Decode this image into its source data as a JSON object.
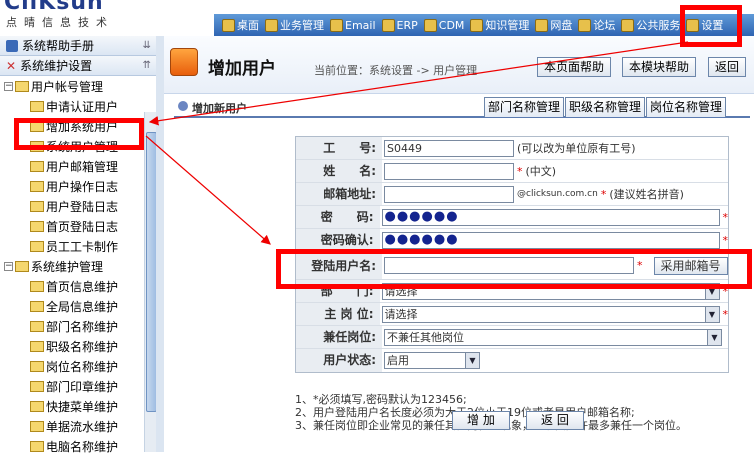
{
  "header": {
    "logo_text": "CliKsun",
    "logo_sub": "点晴信息技术",
    "nav_items": [
      {
        "label": "桌面",
        "icon": "desktop-icon"
      },
      {
        "label": "业务管理",
        "icon": "business-icon"
      },
      {
        "label": "Email",
        "icon": "email-icon"
      },
      {
        "label": "ERP",
        "icon": "erp-icon"
      },
      {
        "label": "CDM",
        "icon": "cdm-icon"
      },
      {
        "label": "知识管理",
        "icon": "knowledge-icon"
      },
      {
        "label": "网盘",
        "icon": "disk-icon"
      },
      {
        "label": "论坛",
        "icon": "forum-icon"
      },
      {
        "label": "公共服务",
        "icon": "service-icon"
      },
      {
        "label": "设置",
        "icon": "settings-icon"
      }
    ]
  },
  "sidebar": {
    "sections": [
      {
        "label": "系统帮助手册"
      },
      {
        "label": "系统维护设置"
      }
    ],
    "tree": [
      {
        "label": "用户帐号管理",
        "level": 0,
        "expanded": true
      },
      {
        "label": "申请认证用户",
        "level": 1
      },
      {
        "label": "增加系统用户",
        "level": 1,
        "selected": true
      },
      {
        "label": "系统用户管理",
        "level": 1
      },
      {
        "label": "用户邮箱管理",
        "level": 1
      },
      {
        "label": "用户操作日志",
        "level": 1
      },
      {
        "label": "用户登陆日志",
        "level": 1
      },
      {
        "label": "首页登陆日志",
        "level": 1
      },
      {
        "label": "员工工卡制作",
        "level": 1
      },
      {
        "label": "系统维护管理",
        "level": 0,
        "expanded": true
      },
      {
        "label": "首页信息维护",
        "level": 1
      },
      {
        "label": "全局信息维护",
        "level": 1
      },
      {
        "label": "部门名称维护",
        "level": 1
      },
      {
        "label": "职级名称维护",
        "level": 1
      },
      {
        "label": "岗位名称维护",
        "level": 1
      },
      {
        "label": "部门印章维护",
        "level": 1
      },
      {
        "label": "快捷菜单维护",
        "level": 1
      },
      {
        "label": "单据流水维护",
        "level": 1
      },
      {
        "label": "电脑名称维护",
        "level": 1
      }
    ]
  },
  "main": {
    "title": "增加用户",
    "location": "当前位置：系统设置 -> 用户管理",
    "buttons": {
      "page_help": "本页面帮助",
      "module_help": "本模块帮助",
      "back": "返回"
    },
    "tab_title": "增加新用户",
    "tabs": [
      "部门名称管理",
      "职级名称管理",
      "岗位名称管理"
    ],
    "form": {
      "employee_no": {
        "label": "工　　号:",
        "value": "S0449",
        "hint": "(可以改为单位原有工号)"
      },
      "name": {
        "label": "姓　　名:",
        "value": "",
        "hint": "(中文)"
      },
      "email": {
        "label": "邮箱地址:",
        "value": "",
        "suffix": "@clicksun.com.cn",
        "hint": "(建议姓名拼音)"
      },
      "password": {
        "label": "密　　码:",
        "value": "●●●●●●"
      },
      "confirm": {
        "label": "密码确认:",
        "value": "●●●●●●"
      },
      "login_name": {
        "label": "登陆用户名:",
        "value": "",
        "button": "采用邮箱号"
      },
      "department": {
        "label": "部　　门:",
        "value": "请选择"
      },
      "position": {
        "label": "主 岗 位:",
        "value": "请选择"
      },
      "concurrent": {
        "label": "兼任岗位:",
        "value": "不兼任其他岗位"
      },
      "status": {
        "label": "用户状态:",
        "value": "启用"
      }
    },
    "notes": [
      "1、*必须填写,密码默认为123456;",
      "2、用户登陆用户名长度必须为大于2位小于19位或者是用户邮箱名称;",
      "3、兼任岗位即企业常见的兼任其他岗位的现象，系统只允许最多兼任一个岗位。"
    ],
    "actions": {
      "add": "增 加",
      "back": "返 回"
    }
  },
  "colors": {
    "nav_bg": "#2f64b2",
    "highlight": "#ff0000",
    "required": "#dd0000"
  }
}
